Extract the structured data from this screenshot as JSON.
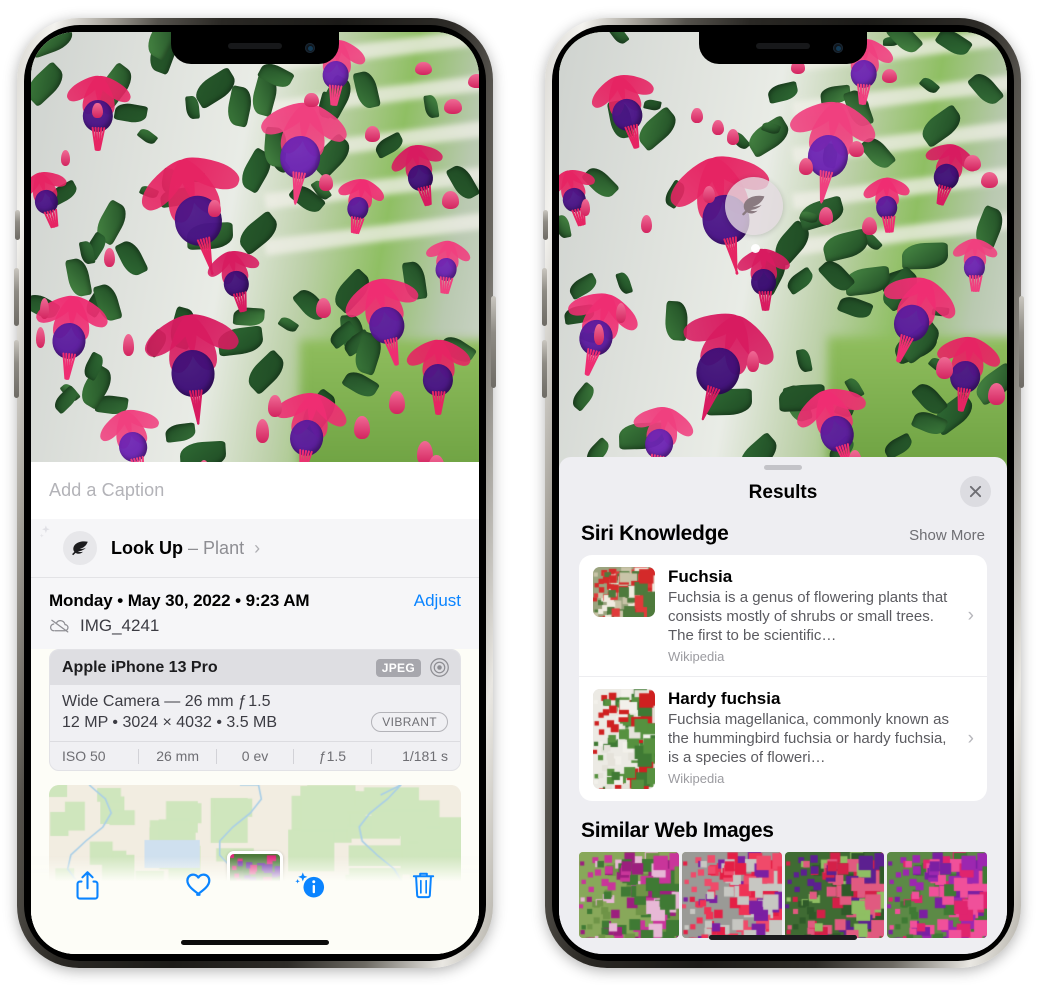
{
  "app": {
    "name": "Photos",
    "platform": "iOS"
  },
  "colors": {
    "accent": "#0a84ff",
    "sheet_bg": "#eeeef2",
    "card_bg": "#ffffff",
    "secondary_text": "#8e8e93"
  },
  "left_phone": {
    "caption": {
      "placeholder": "Add a Caption",
      "value": ""
    },
    "lookup": {
      "label": "Look Up",
      "dash": "–",
      "subject": "Plant",
      "chevron": "›",
      "icon": "leaf-icon"
    },
    "metadata": {
      "date_line": "Monday • May 30, 2022 • 9:23 AM",
      "adjust_label": "Adjust",
      "filename": "IMG_4241",
      "cloud_icon": "icloud-slash-icon"
    },
    "camera_card": {
      "device": "Apple iPhone 13 Pro",
      "format_badge": "JPEG",
      "aperture_icon": "camera-aperture-icon",
      "lens_line": "Wide Camera — 26 mm ƒ 1.5",
      "size_line": "12 MP • 3024 × 4032 • 3.5 MB",
      "style_badge": "VIBRANT",
      "exif": [
        "ISO 50",
        "26 mm",
        "0 ev",
        "ƒ1.5",
        "1/181 s"
      ]
    },
    "toolbar": [
      {
        "name": "share-button",
        "icon": "share-icon"
      },
      {
        "name": "favorite-button",
        "icon": "heart-icon"
      },
      {
        "name": "info-button",
        "icon": "info-sparkle-icon"
      },
      {
        "name": "delete-button",
        "icon": "trash-icon"
      }
    ]
  },
  "right_phone": {
    "badge": {
      "icon": "leaf-icon"
    },
    "sheet": {
      "title": "Results",
      "close_icon": "close-icon"
    },
    "siri_knowledge": {
      "title": "Siri Knowledge",
      "action": "Show More",
      "items": [
        {
          "title": "Fuchsia",
          "description": "Fuchsia is a genus of flowering plants that consists mostly of shrubs or small trees. The first to be scientific…",
          "source": "Wikipedia",
          "chevron": "›"
        },
        {
          "title": "Hardy fuchsia",
          "description": "Fuchsia magellanica, commonly known as the hummingbird fuchsia or hardy fuchsia, is a species of floweri…",
          "source": "Wikipedia",
          "chevron": "›"
        }
      ]
    },
    "similar_web_images": {
      "title": "Similar Web Images",
      "count": 4
    }
  }
}
